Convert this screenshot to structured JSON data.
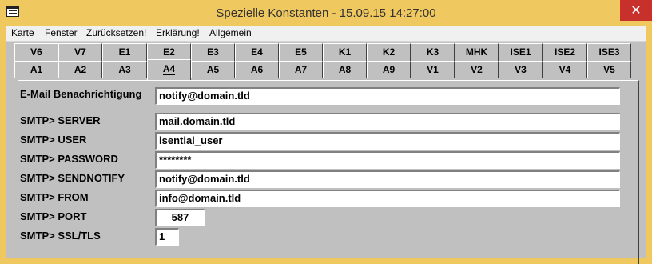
{
  "window": {
    "title": "Spezielle Konstanten   -   15.09.15  14:27:00",
    "close": "✕"
  },
  "menu": [
    "Karte",
    "Fenster",
    "Zurücksetzen!",
    "Erklärung!",
    "Allgemein"
  ],
  "tabs_row1": [
    "V6",
    "V7",
    "E1",
    "E2",
    "E3",
    "E4",
    "E5",
    "K1",
    "K2",
    "K3",
    "MHK",
    "ISE1",
    "ISE2",
    "ISE3"
  ],
  "tabs_row2": [
    "A1",
    "A2",
    "A3",
    "A4",
    "A5",
    "A6",
    "A7",
    "A8",
    "A9",
    "V1",
    "V2",
    "V3",
    "V4",
    "V5"
  ],
  "active_tab": "A4",
  "form": {
    "email": {
      "label": "E-Mail Benachrichtigung",
      "value": "notify@domain.tld"
    },
    "server": {
      "label": "SMTP> SERVER",
      "value": "mail.domain.tld"
    },
    "user": {
      "label": "SMTP> USER",
      "value": "isential_user"
    },
    "password": {
      "label": "SMTP> PASSWORD",
      "value": "********"
    },
    "sendnotify": {
      "label": "SMTP> SENDNOTIFY",
      "value": "notify@domain.tld"
    },
    "from": {
      "label": "SMTP> FROM",
      "value": "info@domain.tld"
    },
    "port": {
      "label": "SMTP> PORT",
      "value": "587"
    },
    "ssl": {
      "label": "SMTP> SSL/TLS",
      "value": "1"
    }
  }
}
